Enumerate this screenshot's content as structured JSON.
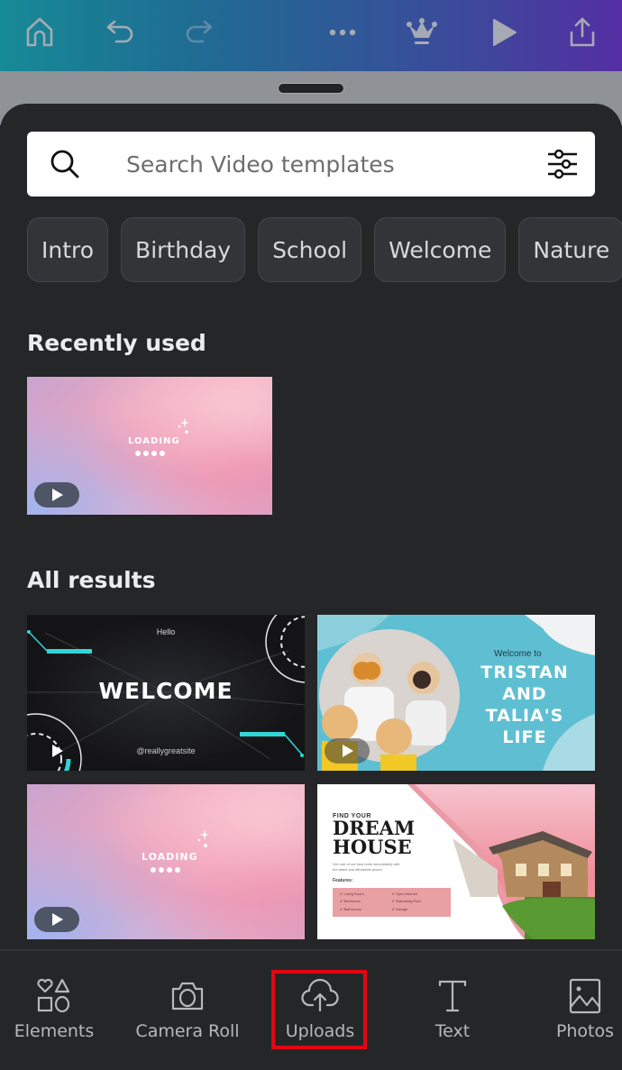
{
  "topbar": {
    "icons": [
      "home-icon",
      "undo-icon",
      "redo-icon",
      "more-icon",
      "crown-icon",
      "play-icon",
      "share-icon"
    ]
  },
  "search": {
    "placeholder": "Search Video templates",
    "value": ""
  },
  "chips": [
    "Intro",
    "Birthday",
    "School",
    "Welcome",
    "Nature"
  ],
  "sections": {
    "recently_used": "Recently used",
    "all_results": "All results"
  },
  "templates": {
    "recent": [
      {
        "title": "LOADING"
      }
    ],
    "results": [
      {
        "hello": "Hello",
        "title": "WELCOME",
        "handle": "@reallygreatsite"
      },
      {
        "subtitle": "Welcome to",
        "title_lines": [
          "TRISTAN",
          "AND TALIA'S",
          "LIFE"
        ]
      },
      {
        "title": "LOADING"
      },
      {
        "kicker": "FIND YOUR",
        "title_lines": [
          "DREAM",
          "HOUSE"
        ],
        "blurb": "Get one of our best units immediately with the latest and affordable prices.",
        "features_label": "Features:",
        "features": [
          "Living Room",
          "Open Kitchen",
          "Bedrooms",
          "Swimming Pool",
          "Bathrooms",
          "Garage"
        ]
      }
    ]
  },
  "bottom_nav": {
    "items": [
      {
        "label": "Elements",
        "icon": "elements-icon"
      },
      {
        "label": "Camera Roll",
        "icon": "camera-icon"
      },
      {
        "label": "Uploads",
        "icon": "upload-cloud-icon",
        "highlighted": true
      },
      {
        "label": "Text",
        "icon": "text-icon"
      },
      {
        "label": "Photos",
        "icon": "photos-icon"
      }
    ]
  },
  "colors": {
    "highlight": "#e30613",
    "panel": "#252628",
    "accent_cyan": "#2fd6d6"
  }
}
